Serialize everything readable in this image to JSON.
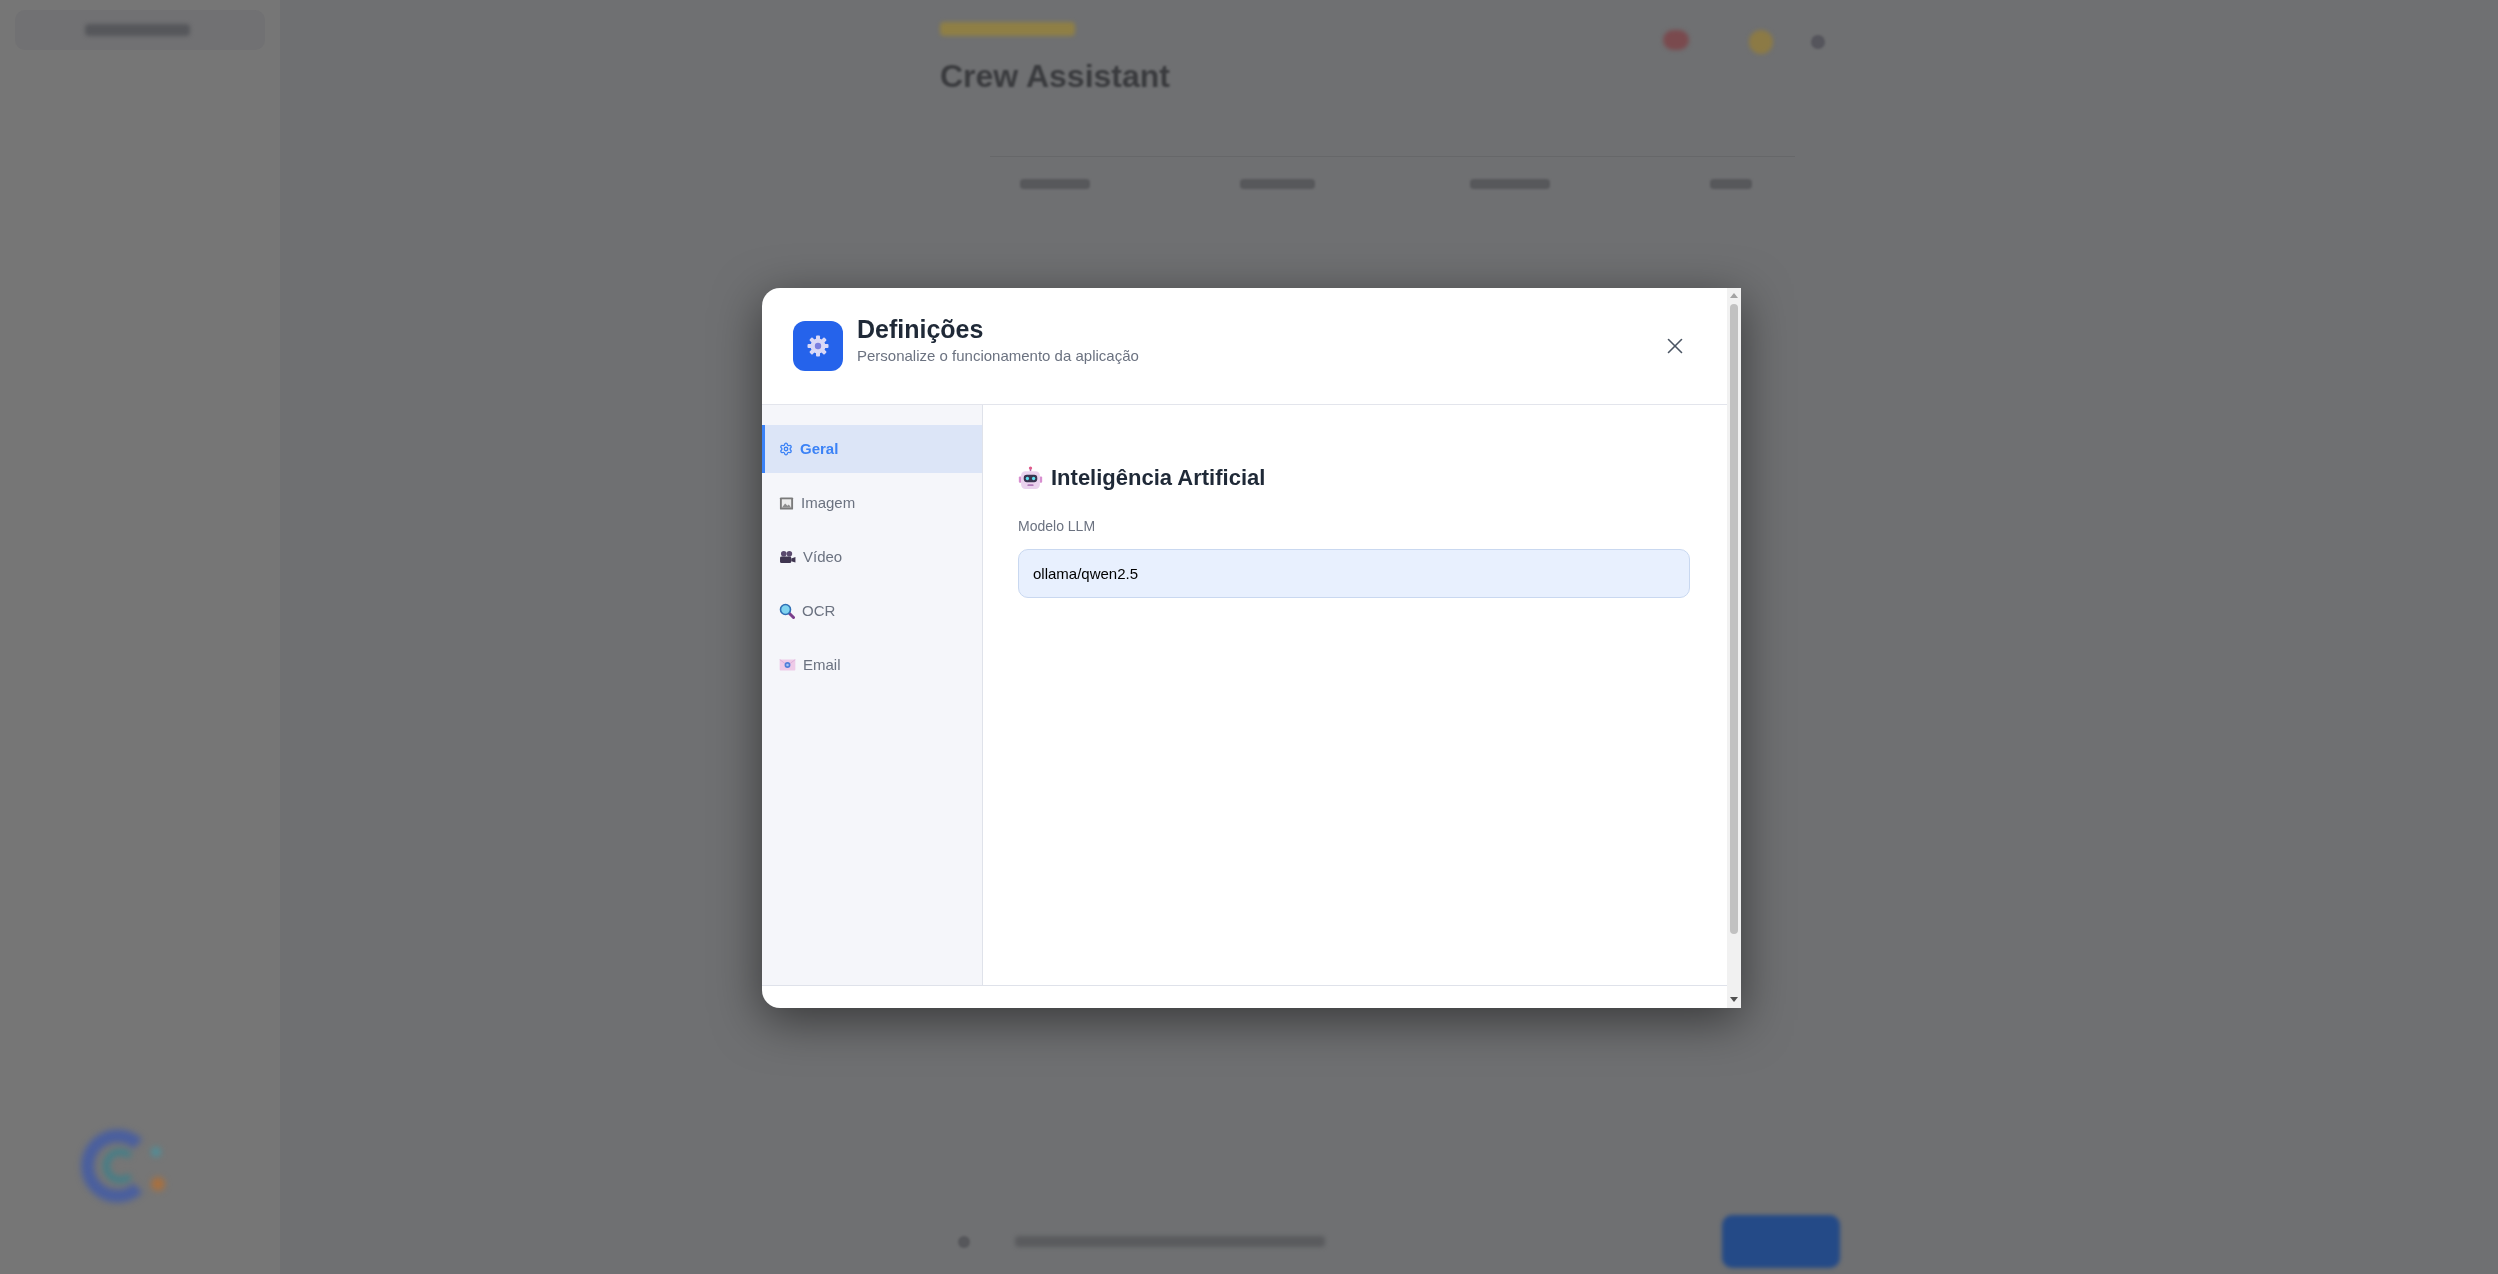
{
  "page": {
    "title": "Crew Assistant"
  },
  "dialog": {
    "title": "Definições",
    "subtitle": "Personalize o funcionamento da aplicação"
  },
  "sidebar": {
    "items": [
      {
        "label": "Geral",
        "selected": true
      },
      {
        "label": "Imagem",
        "selected": false
      },
      {
        "label": "Vídeo",
        "selected": false
      },
      {
        "label": "OCR",
        "selected": false
      },
      {
        "label": "Email",
        "selected": false
      }
    ]
  },
  "section": {
    "title": "Inteligência Artificial",
    "fields": [
      {
        "label": "Modelo LLM",
        "value": "ollama/qwen2.5"
      }
    ]
  }
}
